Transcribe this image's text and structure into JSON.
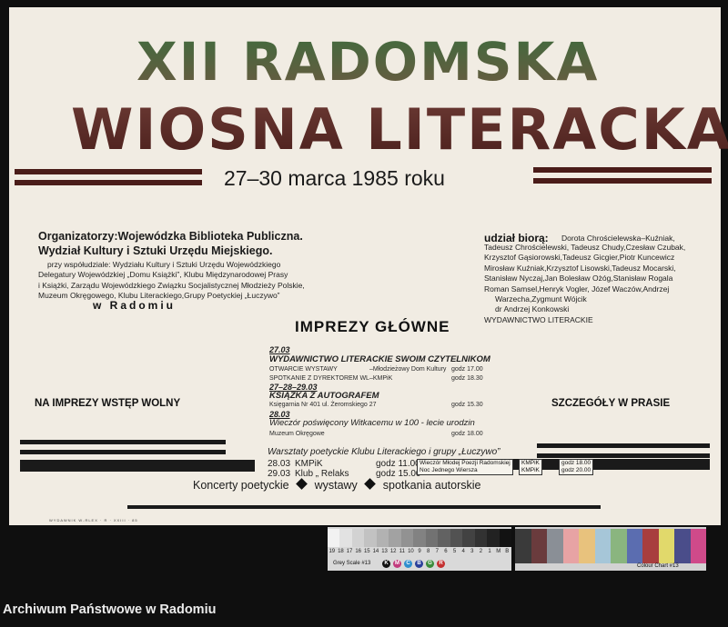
{
  "poster": {
    "title_line1": "XII RADOMSKA",
    "title_line2": "WIOSNA LITERACKA",
    "dates": "27–30 marca 1985 roku",
    "organizers": {
      "title1": "Organizatorzy:Wojewódzka Biblioteka Publiczna.",
      "title2": "Wydział Kultury i Sztuki Urzędu Miejskiego.",
      "lines": [
        "przy współudziale: Wydziału Kultury i Sztuki Urzędu Wojewódzkiego",
        "Delegatury Wojewódzkiej „Domu Książki”, Klubu Międzynarodowej Prasy",
        "i Książki, Zarządu Wojewódzkiego Związku Socjalistycznej Młodzieży Polskie,",
        "Muzeum Okręgowego, Klubu Literackiego,Grupy Poetyckiej „Łuczywo”"
      ],
      "city": "w   Radomiu"
    },
    "participants": {
      "title": "udział biorą:",
      "first": "Dorota Chrościelewska–Kuźniak,",
      "lines": [
        "Tadeusz Chrościelewski, Tadeusz Chudy,Czesław Czubak,",
        "Krzysztof Gąsiorowski,Tadeusz Gicgier,Piotr Kuncewicz",
        "Mirosław Kuźniak,Krzysztof Lisowski,Tadeusz Mocarski,",
        "Stanisław Nyczaj,Jan Bolesław Ożóg,Stanisław Rogala",
        "Roman Samsel,Henryk Vogler, Józef Waczów,Andrzej",
        "Warzecha,Zygmunt Wójcik",
        "dr Andrzej Konkowski",
        "WYDAWNICTWO LITERACKIE"
      ]
    },
    "main_events_title": "IMPREZY GŁÓWNE",
    "events": {
      "e1_date": "27.03",
      "e1_head": "WYDAWNICTWO LITERACKIE SWOIM CZYTELNIKOM",
      "e1_sub1_left": "OTWARCIE WYSTAWY",
      "e1_sub1_mid": "–Młodzieżowy Dom Kultury",
      "e1_sub1_right": "godz 17.00",
      "e1_sub2_left": "SPOTKANIE Z DYREKTOREM WL",
      "e1_sub2_mid": "–KMPiK",
      "e1_sub2_right": "godz 18.30",
      "e2_date": "27–28–29.03",
      "e2_head": "KSIĄŻKA Z AUTOGRAFEM",
      "e2_sub_left": "Księgarnia Nr 401 ul. Żeromskiego 27",
      "e2_sub_right": "godz 15.30",
      "e3_date": "28.03",
      "e3_head": "Wieczór poświęcony Witkacemu w 100 - lecie urodzin",
      "e3_sub_left": "Muzeum Okręgowe",
      "e3_sub_right": "godz 18.00",
      "workshop": "Warsztaty poetyckie Klubu Literackiego i grupy „Łuczywo”",
      "r1_date": "28.03",
      "r1_place": "KMPiK",
      "r1_time": "godz 11.00",
      "r2_date": "29.03",
      "r2_place": "Klub „ Relaks",
      "r2_time": "godz 15.00",
      "box1a": "Wieczór Młodej Poezji Radomskiej",
      "box1b": "Noc Jednego Wiersza",
      "box2a": "KMPiK",
      "box2b": "KMPiK",
      "box3a": "godz   18.00",
      "box3b": "godz   20.00"
    },
    "left_note": "NA IMPREZY WSTĘP WOLNY",
    "right_note": "SZCZEGÓŁY W PRASIE",
    "bottom": {
      "item1": "Koncerty poetyckie",
      "item2": "wystawy",
      "item3": "spotkania  autorskie"
    },
    "credit": "WYDAWNIK W-RLEX · R · XXIII · 85"
  },
  "scale_chart": {
    "grey_label": "Grey Scale #13",
    "grey_numbers": [
      "19",
      "18",
      "17",
      "16",
      "15",
      "14",
      "13",
      "12",
      "11",
      "10",
      "9",
      "8",
      "7",
      "6",
      "5",
      "4",
      "3",
      "2",
      "1",
      "M",
      "B"
    ],
    "color_label": "Colour Chart #13",
    "letters": [
      "K",
      "M",
      "C",
      "B",
      "G",
      "R"
    ],
    "grey_colors": [
      "#f2f2f2",
      "#e2e2e2",
      "#d2d2d2",
      "#c2c2c2",
      "#b2b2b2",
      "#a2a2a2",
      "#929292",
      "#828282",
      "#727272",
      "#626262",
      "#525252",
      "#424242",
      "#323232",
      "#222222",
      "#121212"
    ],
    "color_colors": [
      "#3a3a3a",
      "#6a3b3d",
      "#8a8f96",
      "#e7a3a4",
      "#e8c27d",
      "#a6c6d8",
      "#8ab57f",
      "#5b6db0",
      "#a83e3e",
      "#e1d96b",
      "#4a4d8a",
      "#cf4a8a"
    ]
  },
  "footer": "Archiwum Państwowe w Radomiu"
}
